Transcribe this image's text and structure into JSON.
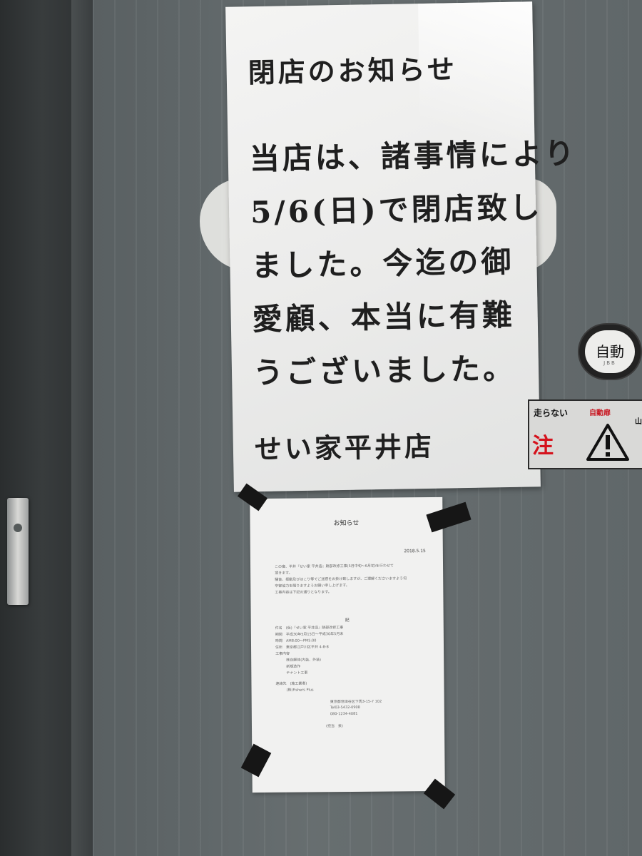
{
  "handwritten_notice": {
    "title": "閉店のお知らせ",
    "lines": [
      "当店は、諸事情により",
      "5/6(日)で閉店致し",
      "ました。今迄の御",
      "愛顧、本当に有難",
      "うございました。"
    ],
    "signature": "せい家平井店"
  },
  "printed_notice": {
    "title": "お知らせ",
    "date": "2018.5.15",
    "body_lines": [
      "この度、平井『せい家 平井店』跡部改修工事(5月中旬〜6月初)を行わせて",
      "頂きます。",
      "騒音、振動及びほこり等でご迷惑をお掛け致しますが、ご理解くださいますよう何",
      "卒御協力を賜りますようお願い申し上げます。",
      "工事内容は下記の通りとなります。"
    ],
    "ki": "記",
    "detail_lines": [
      "件名　(仮)『せい家 平井店』跡部改修工事",
      "期間　平成30年5月15日〜平成30年5月末",
      "時間　AM8:00〜PM5:00",
      "住所　東京都江戸川区平井 4-8-8",
      "工事内容",
      "　　　既存解体(内装、外装)",
      "　　　新規造作",
      "　　　テナント工事"
    ],
    "contact_lines": [
      "連絡先　(施工業者)",
      "　　　(株)Fishers Plus"
    ],
    "contact_right_lines": [
      "東京都世田谷区下馬3-15-7 102",
      "Tel03-5432-0908",
      "080-1234-4081"
    ],
    "contact_name": "(担当　泉)"
  },
  "door_badge": {
    "label": "自動",
    "sub": "JBB"
  },
  "caution_sign": {
    "top_text": "走らない",
    "red_small": "自動扉",
    "edge": "山",
    "red_big": "注"
  },
  "colors": {
    "door": "#656c6e",
    "paper": "#f1f1f0",
    "ink": "#1f1f1f",
    "caution_red": "#d5121c",
    "tape": "#161616"
  }
}
